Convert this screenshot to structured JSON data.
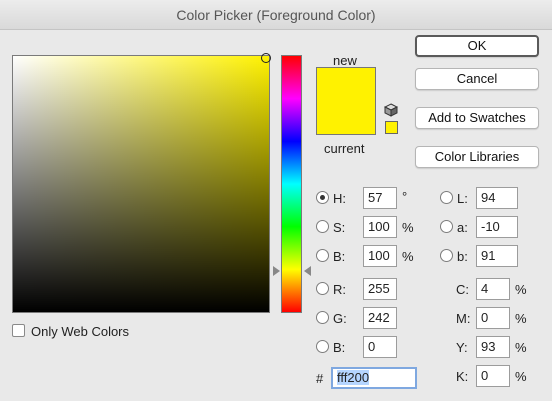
{
  "window": {
    "title": "Color Picker (Foreground Color)"
  },
  "colors": {
    "new": "#fff200",
    "current": "#fff200"
  },
  "buttons": {
    "ok": "OK",
    "cancel": "Cancel",
    "add_to_swatches": "Add to Swatches",
    "color_libraries": "Color Libraries"
  },
  "swatch": {
    "new_label": "new",
    "current_label": "current"
  },
  "only_web_colors": {
    "label": "Only Web Colors",
    "checked": false
  },
  "hsb": {
    "h": {
      "label": "H:",
      "value": "57",
      "unit": "°",
      "selected": true
    },
    "s": {
      "label": "S:",
      "value": "100",
      "unit": "%",
      "selected": false
    },
    "b": {
      "label": "B:",
      "value": "100",
      "unit": "%",
      "selected": false
    }
  },
  "rgb": {
    "r": {
      "label": "R:",
      "value": "255",
      "selected": false
    },
    "g": {
      "label": "G:",
      "value": "242",
      "selected": false
    },
    "b": {
      "label": "B:",
      "value": "0",
      "selected": false
    }
  },
  "lab": {
    "l": {
      "label": "L:",
      "value": "94",
      "selected": false
    },
    "a": {
      "label": "a:",
      "value": "-10",
      "selected": false
    },
    "b": {
      "label": "b:",
      "value": "91",
      "selected": false
    }
  },
  "cmyk": {
    "c": {
      "label": "C:",
      "value": "4",
      "unit": "%"
    },
    "m": {
      "label": "M:",
      "value": "0",
      "unit": "%"
    },
    "y": {
      "label": "Y:",
      "value": "93",
      "unit": "%"
    },
    "k": {
      "label": "K:",
      "value": "0",
      "unit": "%"
    }
  },
  "hex": {
    "label": "#",
    "value": "fff200"
  }
}
